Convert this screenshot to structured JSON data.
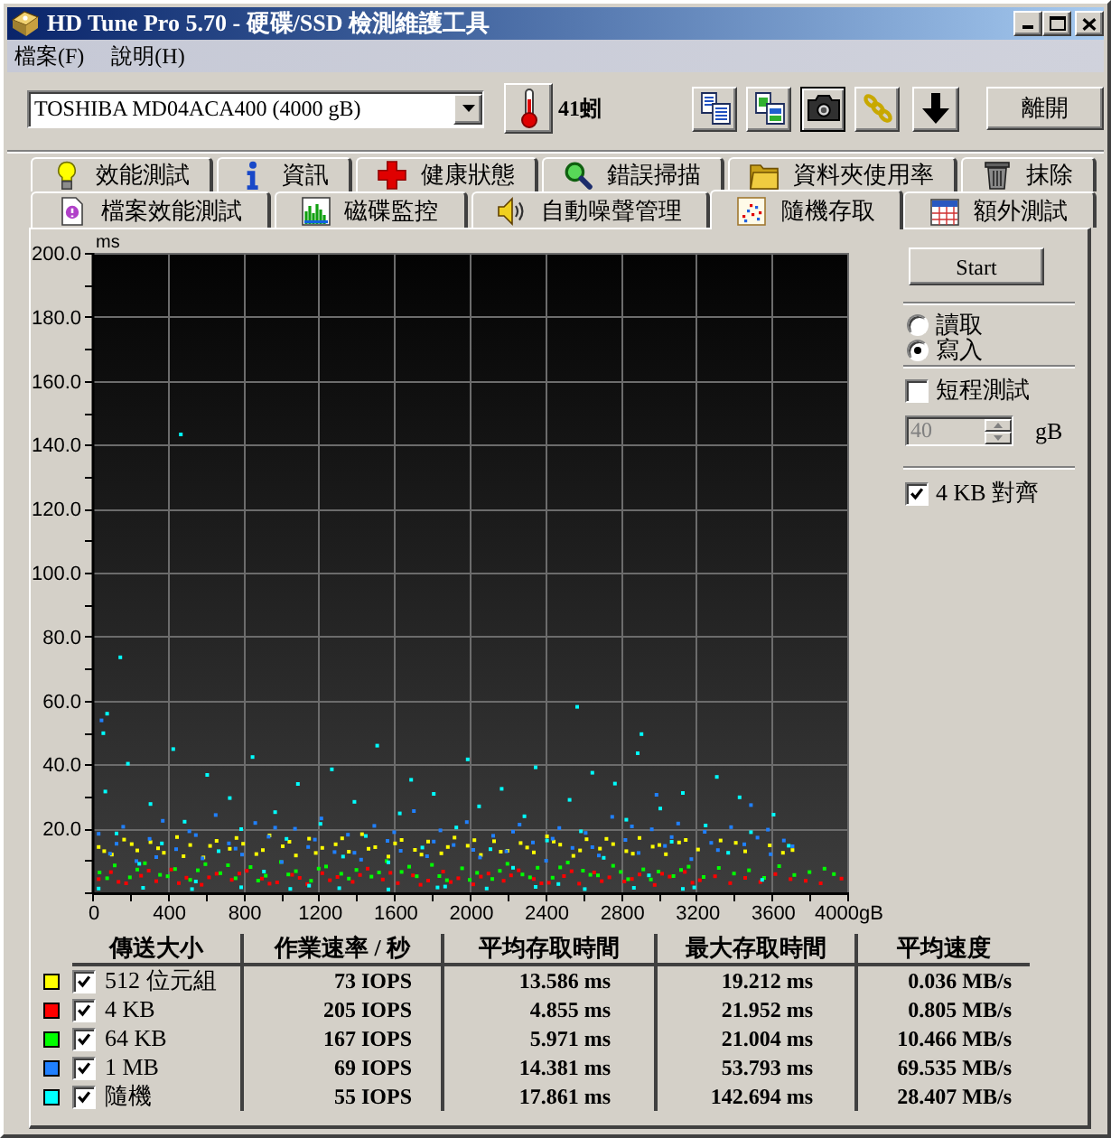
{
  "window": {
    "title": "HD Tune Pro 5.70 - 硬碟/SSD 檢測維護工具"
  },
  "menu": [
    "檔案(F)",
    "說明(H)"
  ],
  "toolbar": {
    "drive": "TOSHIBA MD04ACA400 (4000 gB)",
    "temperature": "41蚓",
    "exit_button": "離開"
  },
  "tab_rows": [
    [
      {
        "label": "效能測試",
        "selected": false
      },
      {
        "label": "資訊",
        "selected": false
      },
      {
        "label": "健康狀態",
        "selected": false
      },
      {
        "label": "錯誤掃描",
        "selected": false
      },
      {
        "label": "資料夾使用率",
        "selected": false
      },
      {
        "label": "抹除",
        "selected": false
      }
    ],
    [
      {
        "label": "檔案效能測試",
        "selected": false
      },
      {
        "label": "磁碟監控",
        "selected": false
      },
      {
        "label": "自動噪聲管理",
        "selected": false
      },
      {
        "label": "隨機存取",
        "selected": true
      },
      {
        "label": "額外測試",
        "selected": false
      }
    ]
  ],
  "random_access": {
    "chart_data": {
      "type": "scatter",
      "ylabel": "ms",
      "grid": true,
      "xlim": [
        0,
        4000
      ],
      "ylim": [
        0,
        200
      ],
      "xticks": [
        0,
        400,
        800,
        1200,
        1600,
        2000,
        2400,
        2800,
        3200,
        3600,
        {
          "value": 4000,
          "label": "4000gB"
        }
      ],
      "yticks": [
        {
          "value": 20,
          "label": "20.0"
        },
        {
          "value": 40,
          "label": "40.0"
        },
        {
          "value": 60,
          "label": "60.0"
        },
        {
          "value": 80,
          "label": "80.0"
        },
        {
          "value": 100,
          "label": "100.0"
        },
        {
          "value": 120,
          "label": "120.0"
        },
        {
          "value": 140,
          "label": "140.0"
        },
        {
          "value": 160,
          "label": "160.0"
        },
        {
          "value": 180,
          "label": "180.0"
        },
        {
          "value": 200,
          "label": "200.0"
        }
      ],
      "series": [
        {
          "color": "#ffff00",
          "x": [
            25,
            95,
            160,
            230,
            300,
            370,
            440,
            510,
            580,
            650,
            720,
            790,
            860,
            930,
            1000,
            1070,
            1140,
            1210,
            1280,
            1350,
            1420,
            1490,
            1560,
            1630,
            1700,
            1770,
            1840,
            1910,
            1980,
            2050,
            2120,
            2190,
            2260,
            2330,
            2400,
            2470,
            2540,
            2610,
            2680,
            2750,
            2820,
            2890,
            2960,
            3030,
            3100,
            3200,
            3320,
            3450,
            3580,
            3700,
            55,
            200,
            340,
            475,
            615,
            755,
            895,
            1035,
            1175,
            1315,
            1455,
            1595,
            1735,
            1875,
            2015,
            2155,
            2295,
            2435,
            2575,
            2715,
            2855,
            2995,
            3135,
            3400,
            3650
          ],
          "values": [
            14.2,
            11.8,
            16.5,
            13.1,
            15.7,
            12.4,
            17.3,
            14.8,
            10.9,
            16.1,
            13.6,
            15.2,
            12.0,
            17.8,
            14.4,
            11.5,
            16.8,
            13.9,
            15.0,
            12.7,
            18.2,
            14.1,
            11.2,
            16.4,
            13.3,
            15.9,
            12.2,
            17.1,
            14.6,
            11.7,
            16.0,
            13.0,
            15.4,
            12.5,
            17.5,
            14.9,
            11.4,
            16.6,
            13.7,
            15.1,
            12.9,
            17.0,
            14.3,
            11.9,
            15.6,
            13.4,
            16.2,
            12.8,
            14.7,
            13.2,
            12.9,
            15.1,
            13.8,
            11.3,
            14.5,
            17.0,
            13.2,
            15.8,
            12.3,
            16.9,
            13.6,
            15.3,
            11.8,
            14.2,
            16.3,
            12.7,
            14.0,
            15.9,
            13.1,
            16.7,
            12.1,
            14.8,
            16.4,
            15.5,
            12.4
          ]
        },
        {
          "color": "#ff0000",
          "x": [
            25,
            90,
            170,
            250,
            330,
            410,
            490,
            570,
            650,
            730,
            810,
            890,
            970,
            1050,
            1130,
            1210,
            1290,
            1370,
            1450,
            1530,
            1610,
            1690,
            1770,
            1850,
            1930,
            2010,
            2090,
            2170,
            2250,
            2330,
            2410,
            2490,
            2570,
            2650,
            2730,
            2810,
            2890,
            2970,
            3050,
            3130,
            3210,
            3290,
            3370,
            3450,
            3530,
            3610,
            3690,
            3770,
            3850,
            3960,
            130,
            290,
            450,
            610,
            770,
            930,
            1090,
            1250,
            1410,
            1570,
            1730,
            1890,
            2050,
            2210,
            2370,
            2530,
            2690,
            2850,
            3010,
            3170
          ],
          "values": [
            4.1,
            6.3,
            2.8,
            5.2,
            3.5,
            7.1,
            4.6,
            2.4,
            5.8,
            3.9,
            6.7,
            4.3,
            3.1,
            5.5,
            2.6,
            6.0,
            4.8,
            3.3,
            7.4,
            4.0,
            2.9,
            5.3,
            3.7,
            6.5,
            4.4,
            2.5,
            5.9,
            3.6,
            6.9,
            4.2,
            3.0,
            5.1,
            2.7,
            6.2,
            4.7,
            3.4,
            5.6,
            2.3,
            4.9,
            6.4,
            3.8,
            5.0,
            2.9,
            4.5,
            3.2,
            5.7,
            4.1,
            3.6,
            2.8,
            4.3,
            3.3,
            6.8,
            2.9,
            4.7,
            5.9,
            2.7,
            4.5,
            3.8,
            5.4,
            6.1,
            2.4,
            3.2,
            4.9,
            5.3,
            2.8,
            6.6,
            3.5,
            4.2,
            5.8,
            3.0
          ]
        },
        {
          "color": "#00ff00",
          "x": [
            30,
            110,
            190,
            270,
            350,
            430,
            510,
            590,
            670,
            750,
            830,
            910,
            990,
            1070,
            1150,
            1230,
            1310,
            1390,
            1470,
            1550,
            1630,
            1710,
            1790,
            1870,
            1950,
            2030,
            2110,
            2190,
            2270,
            2350,
            2430,
            2510,
            2590,
            2670,
            2750,
            2830,
            2910,
            2990,
            3070,
            3150,
            3230,
            3310,
            3390,
            3470,
            3550,
            3630,
            3710,
            3790,
            3870,
            3920,
            70,
            230,
            390,
            550,
            710,
            870,
            1030,
            1190,
            1350,
            1510,
            1670,
            1830,
            1990,
            2150,
            2310,
            2470,
            2630,
            2790,
            2950,
            3110
          ],
          "values": [
            6.2,
            8.4,
            4.7,
            9.1,
            5.5,
            7.3,
            3.9,
            8.8,
            6.0,
            4.4,
            7.9,
            5.2,
            9.5,
            6.6,
            3.6,
            8.1,
            5.8,
            7.0,
            4.9,
            9.8,
            6.4,
            5.0,
            8.6,
            3.8,
            7.5,
            6.1,
            4.2,
            8.9,
            5.6,
            7.7,
            4.6,
            9.3,
            6.8,
            5.3,
            8.3,
            4.1,
            7.2,
            6.5,
            5.1,
            8.0,
            4.8,
            7.6,
            5.9,
            6.9,
            4.5,
            8.2,
            5.4,
            6.3,
            7.4,
            5.7,
            4.4,
            7.1,
            5.0,
            6.9,
            8.5,
            3.7,
            5.6,
            7.4,
            4.3,
            6.2,
            8.0,
            5.1,
            3.9,
            6.7,
            4.7,
            7.8,
            5.5,
            6.4,
            4.0,
            7.0
          ]
        },
        {
          "color": "#2080ff",
          "x": [
            25,
            85,
            155,
            225,
            295,
            365,
            435,
            505,
            575,
            645,
            715,
            785,
            855,
            925,
            995,
            1065,
            1135,
            1205,
            1275,
            1345,
            1415,
            1485,
            1555,
            1625,
            1695,
            1765,
            1835,
            1905,
            1975,
            2045,
            2115,
            2185,
            2255,
            2325,
            2395,
            2465,
            2535,
            2605,
            2675,
            2745,
            2815,
            2885,
            2955,
            3025,
            3095,
            3165,
            3235,
            3305,
            3375,
            3445,
            3515,
            3585,
            3655,
            40,
            2980,
            3480,
            120,
            330,
            540,
            750,
            960,
            1170,
            1380,
            1590,
            1800,
            2010,
            2220,
            2430,
            2640,
            2850,
            3060,
            3270,
            3570,
            3700
          ],
          "values": [
            18.3,
            12.1,
            20.5,
            9.8,
            16.7,
            22.4,
            13.5,
            19.1,
            10.6,
            24.2,
            15.3,
            11.8,
            21.7,
            17.4,
            9.5,
            19.9,
            14.2,
            23.1,
            12.6,
            18.0,
            10.2,
            20.8,
            16.1,
            13.0,
            25.4,
            11.3,
            19.4,
            14.8,
            22.0,
            10.9,
            17.7,
            12.8,
            21.2,
            15.6,
            9.9,
            20.1,
            13.9,
            18.6,
            11.5,
            23.6,
            16.4,
            12.3,
            19.7,
            14.5,
            21.5,
            10.4,
            18.9,
            13.2,
            20.4,
            15.0,
            17.1,
            11.9,
            16.2,
            53.8,
            30.5,
            27.3,
            15.2,
            11.0,
            17.9,
            13.7,
            20.2,
            16.5,
            12.4,
            18.8,
            15.9,
            13.3,
            19.0,
            16.8,
            14.1,
            20.6,
            17.3,
            15.5,
            19.6,
            14.4
          ]
        },
        {
          "color": "#00ffff",
          "x": [
            25,
            60,
            120,
            180,
            240,
            300,
            360,
            420,
            480,
            540,
            600,
            660,
            720,
            780,
            840,
            900,
            960,
            1020,
            1080,
            1140,
            1200,
            1260,
            1320,
            1380,
            1440,
            1500,
            1560,
            1620,
            1680,
            1740,
            1800,
            1860,
            1920,
            1980,
            2040,
            2100,
            2160,
            2220,
            2280,
            2340,
            2400,
            2460,
            2520,
            2580,
            2640,
            2700,
            2760,
            2820,
            2880,
            2940,
            3000,
            3060,
            3120,
            3180,
            3240,
            3300,
            3360,
            3420,
            3480,
            3540,
            3600,
            3680,
            460,
            140,
            2560,
            2900,
            70,
            50,
            260,
            520,
            780,
            1040,
            1300,
            1560,
            1820,
            2080,
            2340,
            2600,
            2860,
            3120
          ],
          "values": [
            1.2,
            31.5,
            18.4,
            40.2,
            8.9,
            27.6,
            15.3,
            44.8,
            22.1,
            3.4,
            36.7,
            12.9,
            29.5,
            19.8,
            42.3,
            6.5,
            25.1,
            16.7,
            33.9,
            2.1,
            21.4,
            38.5,
            11.2,
            28.3,
            17.6,
            45.9,
            9.4,
            24.7,
            35.2,
            14.0,
            30.8,
            1.8,
            20.3,
            41.6,
            26.9,
            13.5,
            32.4,
            7.7,
            23.8,
            39.1,
            16.2,
            2.6,
            28.9,
            19.1,
            37.4,
            10.8,
            34.0,
            22.7,
            43.5,
            5.3,
            26.2,
            15.8,
            31.1,
            1.5,
            20.9,
            36.1,
            12.4,
            29.7,
            18.8,
            3.9,
            24.3,
            14.6,
            143.2,
            73.5,
            58.0,
            49.5,
            55.9,
            49.8,
            1.4,
            1.0,
            1.6,
            1.1,
            1.3,
            0.9,
            1.5,
            1.2,
            1.7,
            1.0,
            1.4,
            1.1
          ]
        }
      ]
    }
  },
  "controls": {
    "start_button": "Start",
    "mode": [
      {
        "label": "讀取",
        "selected": false
      },
      {
        "label": "寫入",
        "selected": true
      }
    ],
    "short_test": {
      "label": "短程測試",
      "checked": false
    },
    "size": {
      "value": "40",
      "unit": "gB",
      "disabled": true
    },
    "align_4kb": {
      "label": "4 KB 對齊",
      "checked": true
    }
  },
  "results": {
    "columns": [
      "傳送大小",
      "作業速率 / 秒",
      "平均存取時間",
      "最大存取時間",
      "平均速度"
    ],
    "rows": [
      {
        "color": "#ffff00",
        "checked": true,
        "label": "512 位元組",
        "iops": "73 IOPS",
        "avg_access": "13.586 ms",
        "max_access": "19.212 ms",
        "avg_speed": "0.036 MB/s"
      },
      {
        "color": "#ff0000",
        "checked": true,
        "label": "4 KB",
        "iops": "205 IOPS",
        "avg_access": "4.855 ms",
        "max_access": "21.952 ms",
        "avg_speed": "0.805 MB/s"
      },
      {
        "color": "#00ff00",
        "checked": true,
        "label": "64 KB",
        "iops": "167 IOPS",
        "avg_access": "5.971 ms",
        "max_access": "21.004 ms",
        "avg_speed": "10.466 MB/s"
      },
      {
        "color": "#2080ff",
        "checked": true,
        "label": "1 MB",
        "iops": "69 IOPS",
        "avg_access": "14.381 ms",
        "max_access": "53.793 ms",
        "avg_speed": "69.535 MB/s"
      },
      {
        "color": "#00ffff",
        "checked": true,
        "label": "隨機",
        "iops": "55 IOPS",
        "avg_access": "17.861 ms",
        "max_access": "142.694 ms",
        "avg_speed": "28.407 MB/s"
      }
    ]
  }
}
